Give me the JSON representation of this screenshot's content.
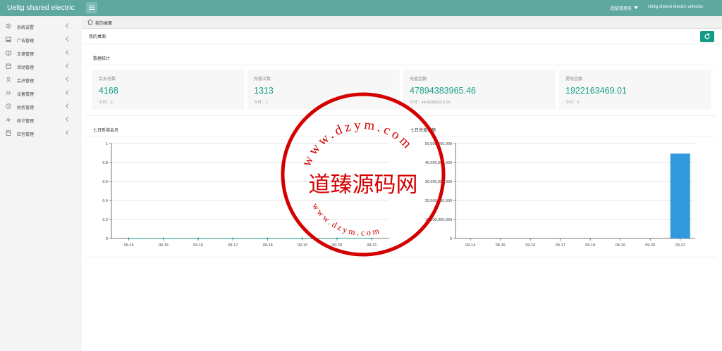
{
  "header": {
    "brand": "Ueltg shared electric",
    "admin_label": "超级管理员",
    "company": "Ueltg shared electric vehicles"
  },
  "sidebar": {
    "items": [
      {
        "label": "系统设置",
        "icon": "gear-icon"
      },
      {
        "label": "广告管理",
        "icon": "image-icon"
      },
      {
        "label": "文章管理",
        "icon": "book-icon"
      },
      {
        "label": "活动管理",
        "icon": "calendar-icon"
      },
      {
        "label": "会员管理",
        "icon": "user-icon"
      },
      {
        "label": "设备管理",
        "icon": "device-icon"
      },
      {
        "label": "财务管理",
        "icon": "money-icon"
      },
      {
        "label": "统计管理",
        "icon": "chart-line-icon"
      },
      {
        "label": "红包管理",
        "icon": "redpacket-icon"
      }
    ]
  },
  "breadcrumb": {
    "home": "我的桌面"
  },
  "page": {
    "title": "我的桌面"
  },
  "stats_section": {
    "title": "数据统计"
  },
  "stats": [
    {
      "label": "会员总数",
      "value": "4168",
      "today": "今日：0"
    },
    {
      "label": "充值次数",
      "value": "1313",
      "today": "今日：1"
    },
    {
      "label": "充值金额",
      "value": "47894383965.46",
      "today": "今日：44682082216.26"
    },
    {
      "label": "提现金额",
      "value": "1922163469.01",
      "today": "今日：0"
    }
  ],
  "colors": {
    "accent": "#1b9e8a",
    "header": "#5ea8a0",
    "bar": "#3399dd"
  },
  "chart_data": [
    {
      "type": "line",
      "title": "七日新增会员",
      "categories": [
        "09-14",
        "09-15",
        "09-16",
        "09-17",
        "09-18",
        "09-19",
        "09-20",
        "09-21"
      ],
      "yticks": [
        "0",
        "0.2",
        "0.4",
        "0.6",
        "0.8",
        "1"
      ],
      "ylim": [
        0,
        1
      ],
      "values": [
        0,
        0,
        0,
        0,
        0,
        0,
        0,
        0
      ]
    },
    {
      "type": "bar",
      "title": "七日充值金额",
      "categories": [
        "09-14",
        "09-15",
        "09-16",
        "09-17",
        "09-18",
        "09-19",
        "09-20",
        "09-21"
      ],
      "yticks": [
        "0",
        "10,000,000,000",
        "20,000,000,000",
        "30,000,000,000",
        "40,000,000,000",
        "50,000,000,000"
      ],
      "ylim": [
        0,
        50000000000
      ],
      "values": [
        0,
        0,
        0,
        0,
        0,
        0,
        0,
        44682082216.26
      ]
    }
  ],
  "watermark": {
    "text": "道臻源码网",
    "ring_top": "www.dzym.com",
    "ring_bottom": "www.dzym.com"
  }
}
